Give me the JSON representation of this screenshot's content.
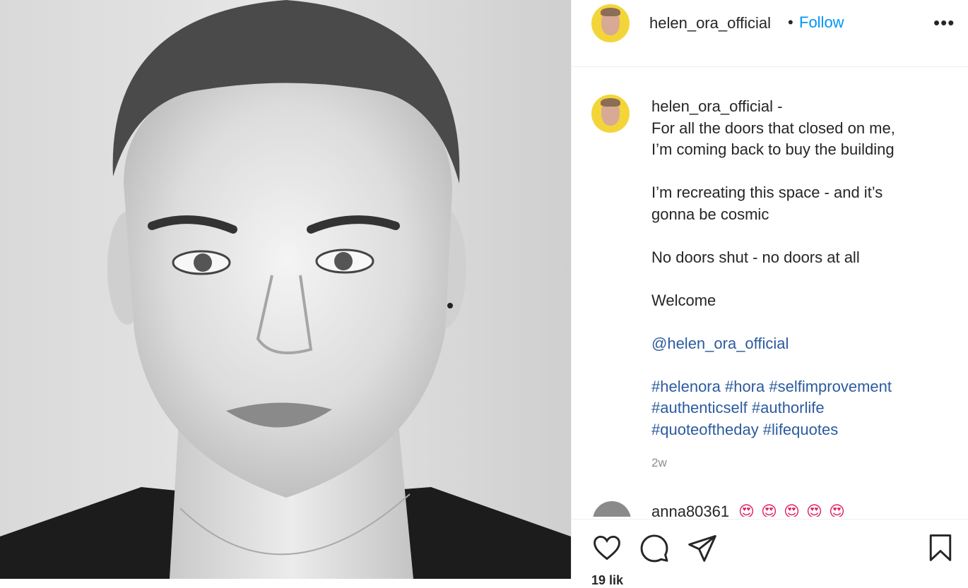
{
  "post": {
    "username": "helen_ora_official",
    "separator": "•",
    "follow_label": "Follow",
    "more_label": "•••"
  },
  "caption": {
    "username": "helen_ora_official",
    "dash": " -",
    "lines": [
      "For all the doors that closed on me,",
      "I’m coming back to buy the building",
      "",
      "I’m recreating this space - and it’s",
      "gonna be cosmic",
      "",
      "No doors shut - no doors at all",
      "",
      "Welcome",
      ""
    ],
    "mention": "@helen_ora_official",
    "hashtag_lines": [
      "#helenora #hora #selfimprovement",
      "#authenticself #authorlife",
      "#quoteoftheday #lifequotes"
    ],
    "time": "2w"
  },
  "comment": {
    "username": "anna80361",
    "emoji_count": 5
  },
  "actions": {
    "likes_text": "19 lik"
  },
  "colors": {
    "follow": "#0095f6",
    "link": "#2c5b9e",
    "avatar_bg": "#f3d53a"
  }
}
